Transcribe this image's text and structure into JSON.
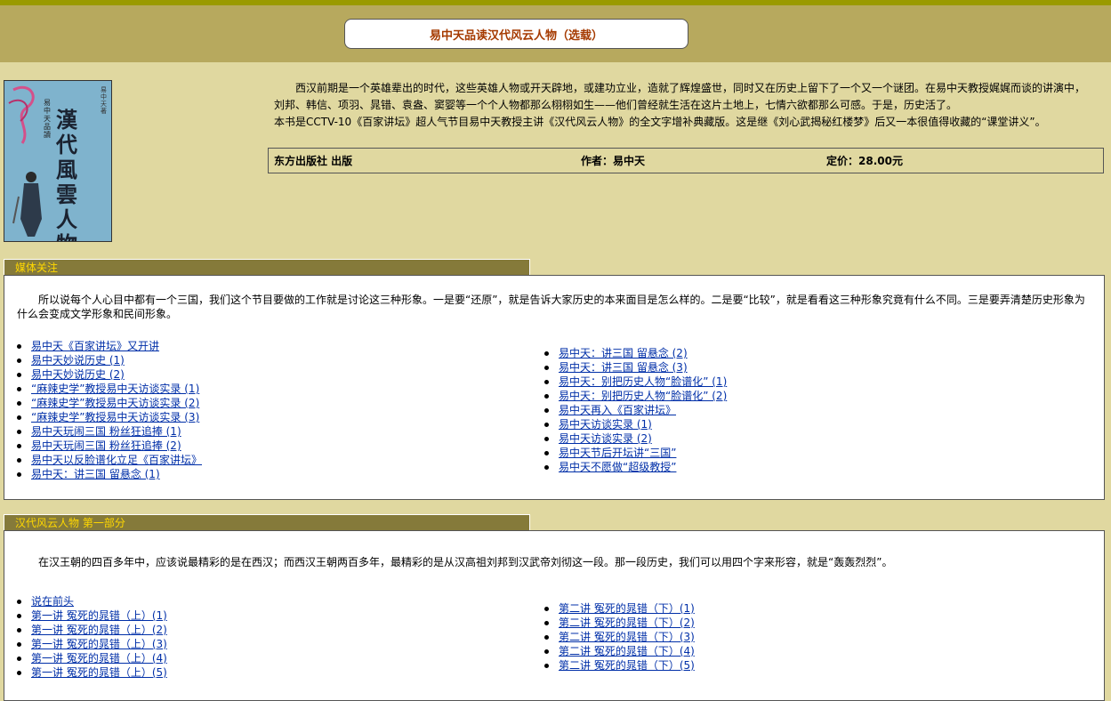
{
  "page": {
    "title": "易中天品读汉代风云人物（选载）"
  },
  "book": {
    "cover": {
      "title": "漢代風雲人物",
      "series": "易中天品讀",
      "author": "易中天著"
    },
    "intro_p1": "西汉前期是一个英雄辈出的时代，这些英雄人物或开天辟地，或建功立业，造就了辉煌盛世，同时又在历史上留下了一个又一个谜团。在易中天教授娓娓而谈的讲演中，刘邦、韩信、项羽、晁错、袁盎、窦婴等一个个人物都那么栩栩如生——他们曾经就生活在这片土地上，七情六欲都那么可感。于是，历史活了。",
    "intro_p2": "本书是CCTV-10《百家讲坛》超人气节目易中天教授主讲《汉代风云人物》的全文字增补典藏版。这是继《刘心武揭秘红楼梦》后又一本很值得收藏的“课堂讲义”。",
    "publisher": "东方出版社 出版",
    "author": "作者：易中天",
    "price": "定价：28.00元"
  },
  "media": {
    "tab": "媒体关注",
    "para": "所以说每个人心目中都有一个三国，我们这个节目要做的工作就是讨论这三种形象。一是要“还原”，就是告诉大家历史的本来面目是怎么样的。二是要“比较”，就是看看这三种形象究竟有什么不同。三是要弄清楚历史形象为什么会变成文学形象和民间形象。",
    "left_links": [
      "易中天《百家讲坛》又开讲",
      "易中天妙说历史 (1)",
      "易中天妙说历史 (2)",
      "“麻辣史学”教授易中天访谈实录 (1)",
      "“麻辣史学”教授易中天访谈实录 (2)",
      "“麻辣史学”教授易中天访谈实录 (3)",
      "易中天玩闹三国 粉丝狂追捧 (1)",
      "易中天玩闹三国 粉丝狂追捧 (2)",
      "易中天以反脸谱化立足《百家讲坛》",
      "易中天：讲三国 留悬念 (1)"
    ],
    "right_links": [
      "易中天：讲三国 留悬念 (2)",
      "易中天：讲三国 留悬念 (3)",
      "易中天：别把历史人物“脸谱化” (1)",
      "易中天：别把历史人物“脸谱化” (2)",
      "易中天再入《百家讲坛》",
      "易中天访谈实录 (1)",
      "易中天访谈实录 (2)",
      "易中天节后开坛讲“三国”",
      "易中天不愿做“超级教授”"
    ]
  },
  "part1": {
    "tab": "汉代风云人物 第一部分",
    "para": "在汉王朝的四百多年中，应该说最精彩的是在西汉；而西汉王朝两百多年，最精彩的是从汉高祖刘邦到汉武帝刘彻这一段。那一段历史，我们可以用四个字来形容，就是“轰轰烈烈”。",
    "left_links": [
      "说在前头",
      "第一讲 冤死的晁错（上）(1)",
      "第一讲 冤死的晁错（上）(2)",
      "第一讲 冤死的晁错（上）(3)",
      "第一讲 冤死的晁错（上）(4)",
      "第一讲 冤死的晁错（上）(5)"
    ],
    "right_links": [
      "第二讲 冤死的晁错（下）(1)",
      "第二讲 冤死的晁错（下）(2)",
      "第二讲 冤死的晁错（下）(3)",
      "第二讲 冤死的晁错（下）(4)",
      "第二讲 冤死的晁错（下）(5)"
    ]
  }
}
